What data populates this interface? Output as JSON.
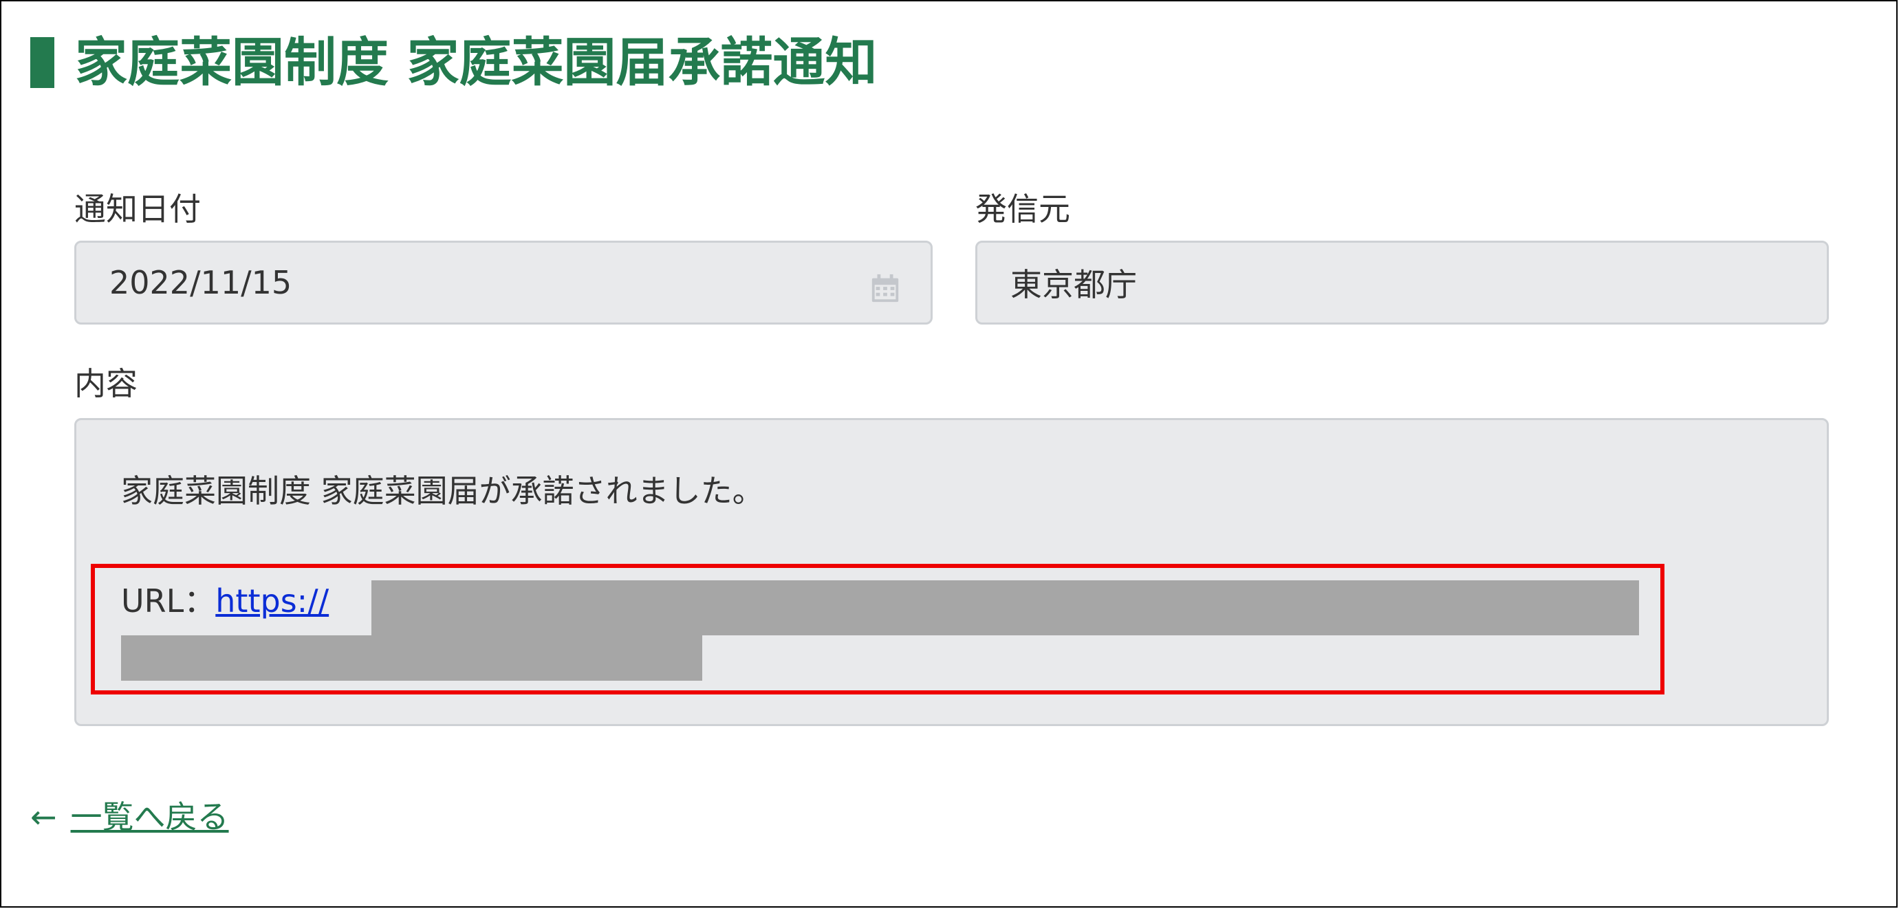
{
  "page": {
    "title": "家庭菜園制度 家庭菜園届承諾通知",
    "accent_color": "#237a4e"
  },
  "form": {
    "date_label": "通知日付",
    "date_value": "2022/11/15",
    "sender_label": "発信元",
    "sender_value": "東京都庁",
    "content_label": "内容",
    "content_text": "家庭菜園制度 家庭菜園届が承諾されました。",
    "url_label": "URL：",
    "url_link_text": "https://"
  },
  "icons": {
    "calendar": "calendar-icon",
    "back_arrow": "←"
  },
  "nav": {
    "back_label": "一覧へ戻る"
  },
  "annotation": {
    "highlight_color": "#ee0000"
  }
}
